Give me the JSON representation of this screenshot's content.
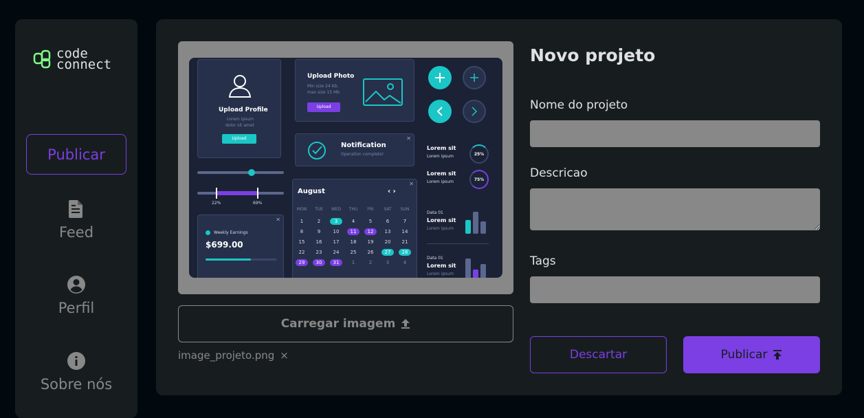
{
  "logo": {
    "line1": "code",
    "line2": "connect"
  },
  "sidebar": {
    "publish_label": "Publicar",
    "items": [
      {
        "label": "Feed",
        "icon": "document-icon"
      },
      {
        "label": "Perfil",
        "icon": "account-circle-icon"
      },
      {
        "label": "Sobre nós",
        "icon": "info-icon"
      }
    ]
  },
  "preview": {
    "mockup": {
      "upload_profile": {
        "title": "Upload Profile",
        "subtitle1": "Lorem ipsum",
        "subtitle2": "dolor sit amet",
        "button": "Upload"
      },
      "upload_photo": {
        "title": "Upload Photo",
        "line1": "Min size 24 Kb,",
        "line2": "max size 15 Mb",
        "button": "Upload"
      },
      "notification": {
        "title": "Notification",
        "subtitle": "Operation complete!"
      },
      "slider": {
        "left_label": "22%",
        "right_label": "69%"
      },
      "earnings": {
        "label": "Weekly Earnings",
        "value": "$699.00"
      },
      "calendar": {
        "month": "August",
        "weekdays": [
          "MON",
          "TUE",
          "WED",
          "THU",
          "FRI",
          "SAT",
          "SUN"
        ],
        "weeks": [
          [
            "1",
            "2",
            "3",
            "4",
            "5",
            "6",
            "7"
          ],
          [
            "8",
            "9",
            "10",
            "11",
            "12",
            "13",
            "14"
          ],
          [
            "15",
            "16",
            "17",
            "18",
            "19",
            "20",
            "21"
          ],
          [
            "22",
            "23",
            "24",
            "25",
            "26",
            "27",
            "28"
          ],
          [
            "29",
            "30",
            "31",
            "1",
            "2",
            "3",
            "4"
          ]
        ]
      },
      "stats": [
        {
          "title": "Lorem sit",
          "subtitle": "Lorem ipsum",
          "value": "25%"
        },
        {
          "title": "Lorem sit",
          "subtitle": "Lorem ipsum",
          "value": "75%"
        }
      ],
      "bars": [
        {
          "caption": "Data 01",
          "title": "Lorem sit",
          "subtitle": "Lorem ipsum"
        },
        {
          "caption": "Data 01",
          "title": "Lorem sit",
          "subtitle": "Lorem ipsum"
        }
      ]
    }
  },
  "upload": {
    "button_label": "Carregar imagem",
    "file_name": "image_projeto.png",
    "remove_symbol": "×"
  },
  "form": {
    "title": "Novo projeto",
    "name_label": "Nome do projeto",
    "name_value": "",
    "description_label": "Descricao",
    "description_value": "",
    "tags_label": "Tags",
    "tags_value": "",
    "discard_label": "Descartar",
    "publish_label": "Publicar"
  },
  "colors": {
    "background": "#01080E",
    "panel": "#171D1F",
    "accent": "#7B3FE4",
    "muted": "#888888",
    "text": "#E1E1E1",
    "logo_green": "#81FE88"
  }
}
